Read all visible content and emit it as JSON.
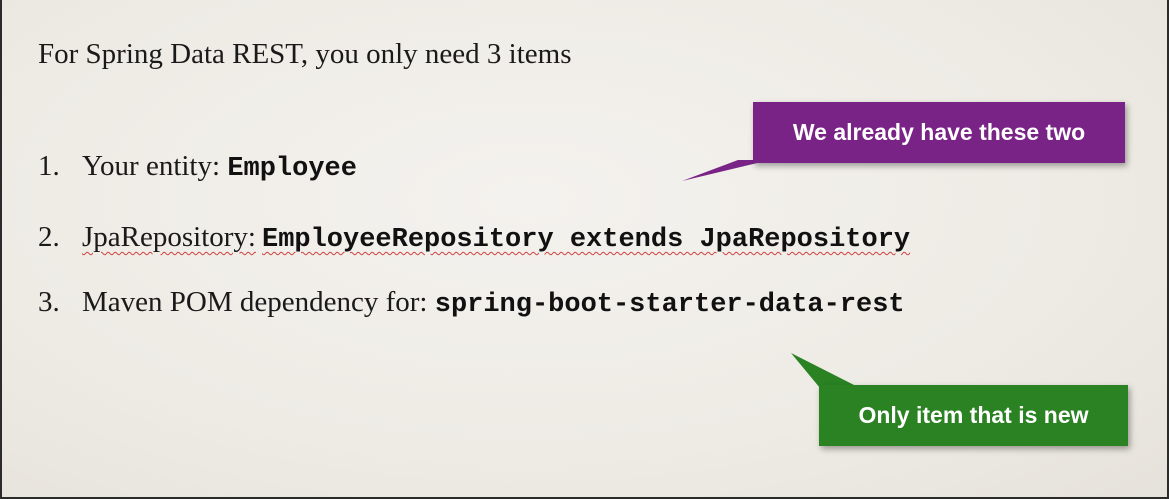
{
  "slide": {
    "title": "For Spring Data REST, you only need 3 items",
    "items": [
      {
        "number": "1.",
        "text": "Your entity: ",
        "code": "Employee"
      },
      {
        "number": "2.",
        "text": "JpaRepository:",
        "code": "EmployeeRepository extends JpaRepository"
      },
      {
        "number": "3.",
        "text": "Maven POM dependency for: ",
        "code": "spring-boot-starter-data-rest"
      }
    ]
  },
  "callouts": {
    "existing": {
      "label": "We already have these two",
      "color": "#7a2387"
    },
    "new": {
      "label": "Only item that is new",
      "color": "#2a8223"
    }
  }
}
